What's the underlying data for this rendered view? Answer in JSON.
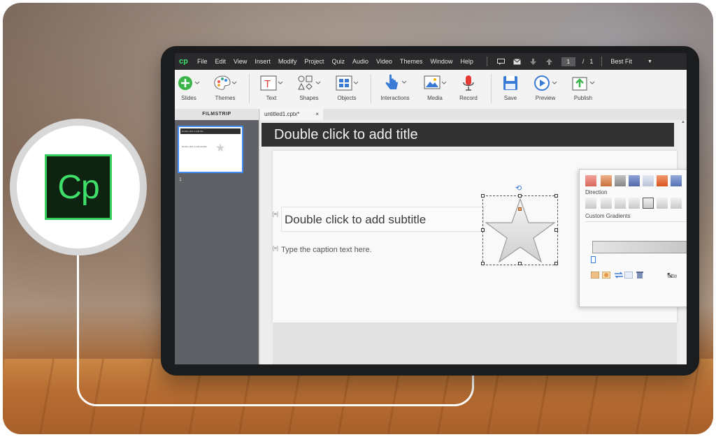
{
  "app": {
    "logo_text": "Cp",
    "menu": [
      "File",
      "Edit",
      "View",
      "Insert",
      "Modify",
      "Project",
      "Quiz",
      "Audio",
      "Video",
      "Themes",
      "Window",
      "Help"
    ],
    "page_current": "1",
    "page_separator": "/",
    "page_total": "1",
    "zoom": "Best Fit"
  },
  "toolbar": {
    "slides": "Slides",
    "themes": "Themes",
    "text": "Text",
    "shapes": "Shapes",
    "objects": "Objects",
    "interactions": "Interactions",
    "media": "Media",
    "record": "Record",
    "save": "Save",
    "preview": "Preview",
    "publish": "Publish"
  },
  "tabs": {
    "filmstrip": "FILMSTRIP",
    "document": "untitled1.cptx*",
    "close": "×"
  },
  "filmstrip": {
    "slide_number": "1",
    "thumb_title": "Double click to add title",
    "thumb_subtitle": "Double click to add subtitle"
  },
  "slide": {
    "title": "Double click to add title",
    "subtitle": "Double click to add subtitle",
    "caption": "Type the caption text here."
  },
  "fill_panel": {
    "direction_label": "Direction",
    "custom_gradients_label": "Custom Gradients",
    "partial_label": "atte",
    "swatch_colors": [
      "#e0857a",
      "#d9845a",
      "#9c9c9c",
      "#6a7fb8",
      "#c7cfe0",
      "#e46b3c",
      "#6b86c2"
    ],
    "accent": "#37cf5b"
  }
}
